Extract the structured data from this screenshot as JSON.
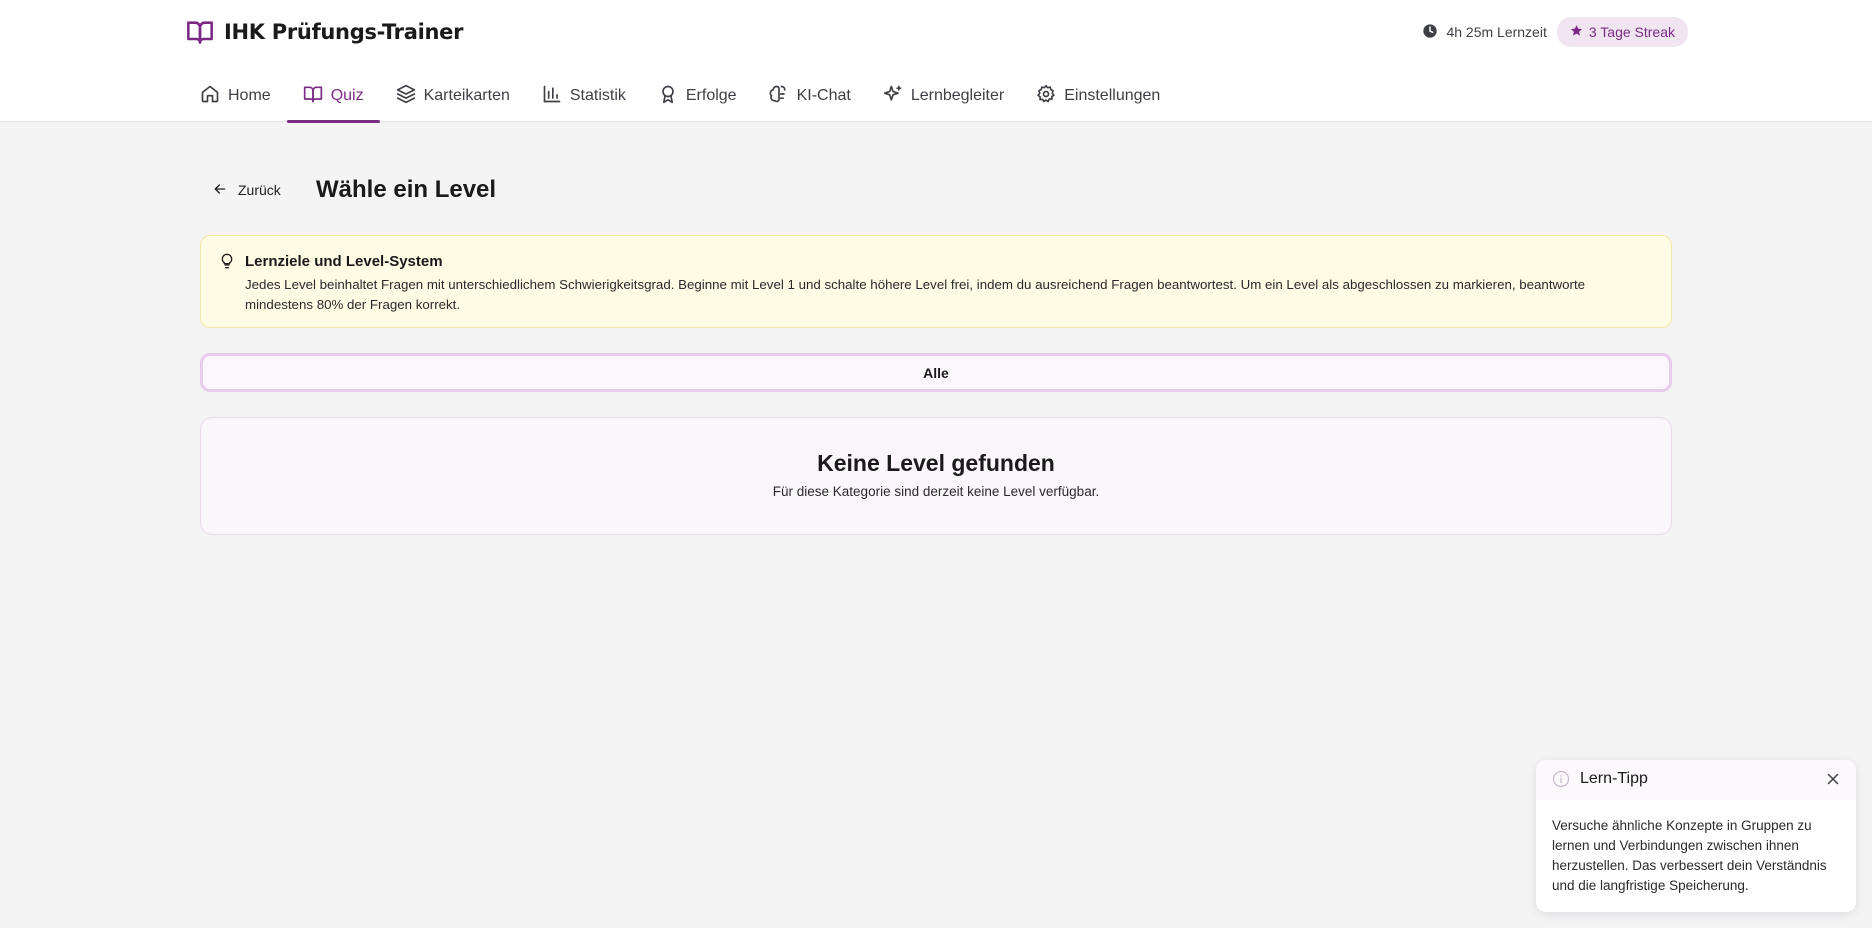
{
  "app": {
    "title": "IHK Prüfungs-Trainer",
    "brand_icon": "book-open-icon",
    "accent_color": "#7a2c84"
  },
  "header": {
    "study_time": "4h 25m Lernzeit",
    "streak": "3 Tage Streak"
  },
  "nav": {
    "items": [
      {
        "label": "Home",
        "icon": "home-icon",
        "active": false
      },
      {
        "label": "Quiz",
        "icon": "book-open-icon",
        "active": true
      },
      {
        "label": "Karteikarten",
        "icon": "layers-icon",
        "active": false
      },
      {
        "label": "Statistik",
        "icon": "bar-chart-icon",
        "active": false
      },
      {
        "label": "Erfolge",
        "icon": "award-icon",
        "active": false
      },
      {
        "label": "KI-Chat",
        "icon": "brain-icon",
        "active": false
      },
      {
        "label": "Lernbegleiter",
        "icon": "sparkles-icon",
        "active": false
      },
      {
        "label": "Einstellungen",
        "icon": "gear-icon",
        "active": false
      }
    ]
  },
  "page": {
    "back_label": "Zurück",
    "title": "Wähle ein Level"
  },
  "info": {
    "title": "Lernziele und Level-System",
    "text": "Jedes Level beinhaltet Fragen mit unterschiedlichem Schwierigkeitsgrad. Beginne mit Level 1 und schalte höhere Level frei, indem du ausreichend Fragen beantwortest. Um ein Level als abgeschlossen zu markieren, beantworte mindestens 80% der Fragen korrekt."
  },
  "filter": {
    "label": "Alle"
  },
  "empty": {
    "title": "Keine Level gefunden",
    "text": "Für diese Kategorie sind derzeit keine Level verfügbar."
  },
  "toast": {
    "title": "Lern-Tipp",
    "text": "Versuche ähnliche Konzepte in Gruppen zu lernen und Verbindungen zwischen ihnen herzustellen. Das verbessert dein Verständnis und die langfristige Speicherung."
  }
}
